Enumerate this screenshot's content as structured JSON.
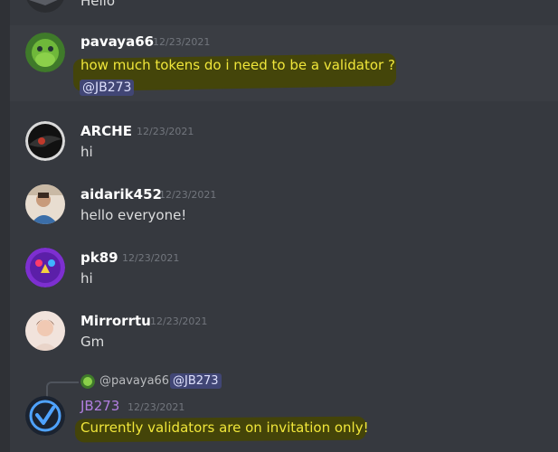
{
  "messages": [
    {
      "id": "top",
      "username": "",
      "timestamp": "",
      "text": "Hello",
      "avatar": "dark-winged-avatar"
    },
    {
      "id": "pavaya",
      "username": "pavaya66",
      "timestamp": "12/23/2021",
      "text": "how much tokens do i need to be a validator ?",
      "mention": "@JB273",
      "avatar": "green-creature-avatar",
      "highlighted": true
    },
    {
      "id": "arche",
      "username": "ARCHE",
      "timestamp": "12/23/2021",
      "text": "hi",
      "avatar": "black-winged-emblem-avatar"
    },
    {
      "id": "aidarik",
      "username": "aidarik452",
      "timestamp": "12/23/2021",
      "text": "hello everyone!",
      "avatar": "person-photo-avatar"
    },
    {
      "id": "pk89",
      "username": "pk89",
      "timestamp": "12/23/2021",
      "text": "hi",
      "avatar": "purple-robot-face-avatar"
    },
    {
      "id": "mirror",
      "username": "Mirrorrtu",
      "timestamp": "12/23/2021",
      "text": "Gm",
      "avatar": "woman-photo-avatar"
    },
    {
      "id": "jb273",
      "username": "JB273",
      "timestamp": "12/23/2021",
      "text": "Currently validators are on invitation only!",
      "avatar": "blue-check-logo-avatar",
      "reply": {
        "username": "@pavaya66",
        "mention": "@JB273"
      }
    }
  ],
  "colors": {
    "background": "#36393f",
    "username": "#ffffff",
    "jb273_username": "#b27fe0",
    "highlight_text": "#f0e63a",
    "mention_bg": "#414675"
  }
}
